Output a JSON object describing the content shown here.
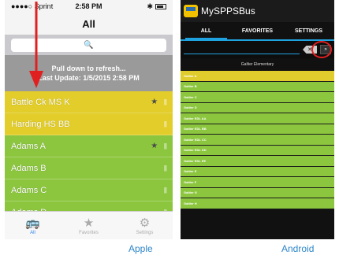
{
  "apple": {
    "status": {
      "carrier": "●●●●○ Sprint",
      "time": "2:58 PM",
      "bt": "✱"
    },
    "title": "All",
    "search_placeholder": "🔍",
    "pull_text": "Pull down to refresh...",
    "last_update": "Last Update: 1/5/2015 2:58 PM",
    "rows": [
      {
        "name": "Battle Ck MS K",
        "color": "yellow",
        "starred": true
      },
      {
        "name": "Harding HS BB",
        "color": "yellow",
        "starred": false
      },
      {
        "name": "Adams A",
        "color": "green",
        "starred": true
      },
      {
        "name": "Adams B",
        "color": "green",
        "starred": false
      },
      {
        "name": "Adams C",
        "color": "green",
        "starred": false
      },
      {
        "name": "Adams D",
        "color": "green",
        "starred": false
      }
    ],
    "tabs": [
      {
        "label": "All",
        "icon": "bus-icon"
      },
      {
        "label": "Favorites",
        "icon": "star-icon"
      },
      {
        "label": "Settings",
        "icon": "gear-icon"
      }
    ],
    "caption": "Apple"
  },
  "android": {
    "app_title": "MySPPSBus",
    "tabs": [
      "ALL",
      "FAVORITES",
      "SETTINGS"
    ],
    "clear_label": "✕",
    "go_label": "»",
    "header": "Galtier Elementary",
    "rows": [
      {
        "name": "Galtier A",
        "color": "yellow"
      },
      {
        "name": "Galtier B",
        "color": "green"
      },
      {
        "name": "Galtier C",
        "color": "green"
      },
      {
        "name": "Galtier D",
        "color": "green"
      },
      {
        "name": "Galtier EDL AA",
        "color": "green"
      },
      {
        "name": "Galtier EDL BB",
        "color": "green"
      },
      {
        "name": "Galtier EDL CC",
        "color": "green"
      },
      {
        "name": "Galtier EDL DD",
        "color": "green"
      },
      {
        "name": "Galtier EDL EE",
        "color": "green"
      },
      {
        "name": "Galtier E",
        "color": "green"
      },
      {
        "name": "Galtier F",
        "color": "green"
      },
      {
        "name": "Galtier G",
        "color": "green"
      },
      {
        "name": "Galtier H",
        "color": "green"
      }
    ],
    "caption": "Android"
  },
  "colors": {
    "yellow": "#e2cd2a",
    "green": "#8cc63f",
    "accent_blue": "#1fa3e0",
    "highlight_red": "#e02020"
  }
}
